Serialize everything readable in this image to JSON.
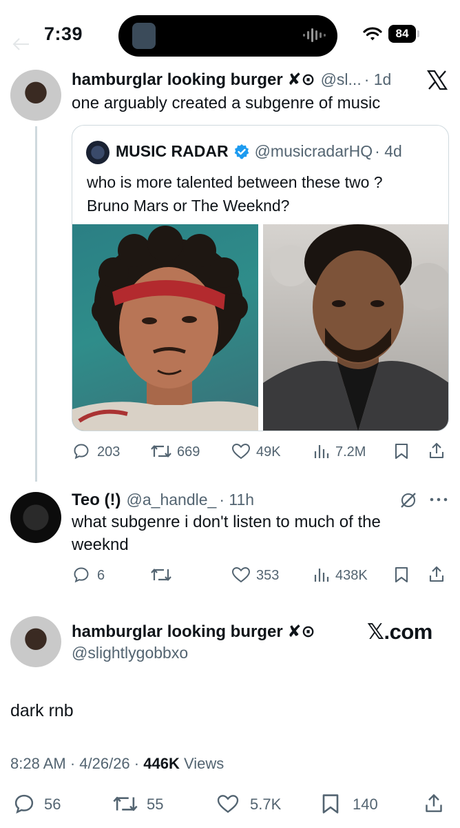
{
  "status_bar": {
    "time": "7:39",
    "battery": "84"
  },
  "tweet1": {
    "name": "hamburglar looking burger ✘⊙",
    "handle": "@sl...",
    "time": "· 1d",
    "text": "one arguably created a subgenre of music"
  },
  "quote": {
    "name": "MUSIC RADAR",
    "handle": "@musicradarHQ",
    "time": "· 4d",
    "text_line1": "who is more talented between these two ?",
    "text_line2": "Bruno Mars or The Weeknd?"
  },
  "tweet1_stats": {
    "replies": "203",
    "retweets": "669",
    "likes": "49K",
    "views": "7.2M"
  },
  "tweet2": {
    "name": "Teo (!)",
    "handle": "@a_handle_",
    "time": "· 11h",
    "text_line1": "what subgenre i don't listen to much of the",
    "text_line2": "weeknd"
  },
  "tweet2_stats": {
    "replies": "6",
    "likes": "353",
    "views": "438K"
  },
  "main": {
    "name": "hamburglar looking burger ✘⊙",
    "handle": "@slightlygobbxo",
    "watermark": "𝕏.com",
    "text": "dark rnb",
    "time": "8:28 AM · 4/26/26 · ",
    "views_count": "446K",
    "views_label": " Views"
  },
  "main_stats": {
    "replies": "56",
    "retweets": "55",
    "likes": "5.7K",
    "bookmarks": "140"
  }
}
